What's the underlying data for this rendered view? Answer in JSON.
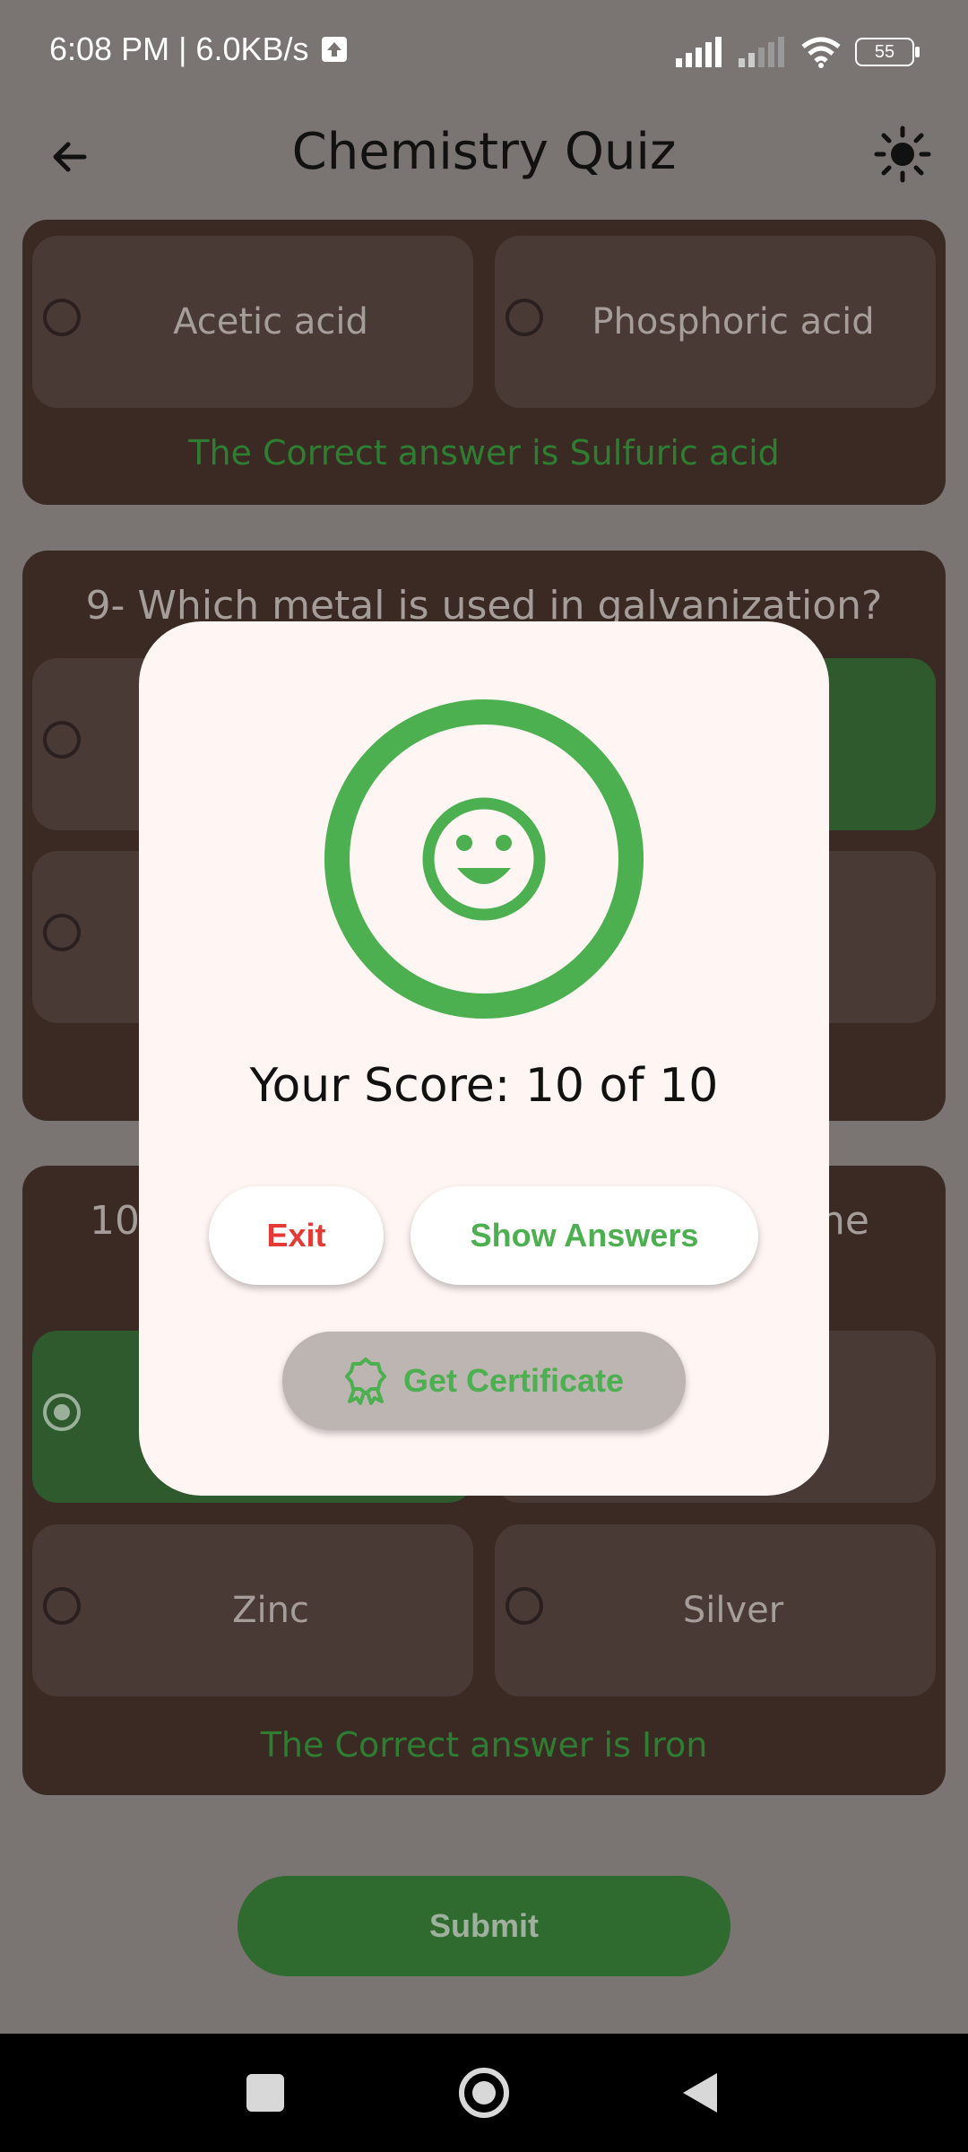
{
  "status_bar": {
    "time_speed": "6:08 PM | 6.0KB/s",
    "battery": "55"
  },
  "app_bar": {
    "title": "Chemistry Quiz"
  },
  "question8": {
    "options": [
      "Acetic acid",
      "Phosphoric acid"
    ],
    "correct_answer_text": "The Correct answer is Sulfuric acid"
  },
  "question9": {
    "text": "9- Which metal is used in galvanization?"
  },
  "question10": {
    "text_left": "10",
    "text_right": "he",
    "options": [
      "Zinc",
      "Silver"
    ],
    "correct_answer_text": "The Correct answer is Iron"
  },
  "submit_label": "Submit",
  "dialog": {
    "score_text": "Your Score: 10 of 10",
    "score": 10,
    "total": 10,
    "exit_label": "Exit",
    "show_answers_label": "Show Answers",
    "certificate_label": "Get Certificate"
  },
  "colors": {
    "accent": "#4caf50",
    "exit": "#e53935",
    "card": "#3a2a23"
  },
  "icons": [
    "back-arrow-icon",
    "sun-icon",
    "smile-icon",
    "award-icon",
    "upload-icon"
  ]
}
